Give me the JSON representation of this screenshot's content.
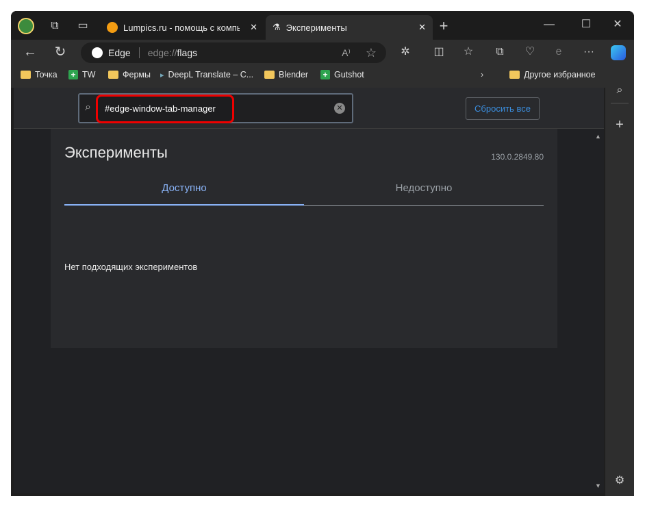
{
  "tabs": [
    {
      "label": "Lumpics.ru - помощь с компьютером",
      "icon": "orange-icon"
    },
    {
      "label": "Эксперименты",
      "icon": "flask-icon",
      "active": true
    }
  ],
  "address": {
    "site_label": "Edge",
    "url_prefix": "edge://",
    "url_path": "flags"
  },
  "bookmarks": [
    {
      "label": "Точка",
      "icon": "folder-icon"
    },
    {
      "label": "TW",
      "icon": "sheets-icon"
    },
    {
      "label": "Фермы",
      "icon": "folder-icon"
    },
    {
      "label": "DeepL Translate – C...",
      "icon": "deepl-icon"
    },
    {
      "label": "Blender",
      "icon": "folder-icon"
    },
    {
      "label": "Gutshot",
      "icon": "sheets-icon"
    }
  ],
  "other_favorites": "Другое избранное",
  "flags": {
    "search_value": "#edge-window-tab-manager",
    "reset_label": "Сбросить все",
    "title": "Эксперименты",
    "version": "130.0.2849.80",
    "tab_available": "Доступно",
    "tab_unavailable": "Недоступно",
    "empty_message": "Нет подходящих экспериментов"
  },
  "colors": {
    "accent": "#8ab4f8",
    "highlight": "#e00000",
    "link": "#3b8fe0"
  }
}
